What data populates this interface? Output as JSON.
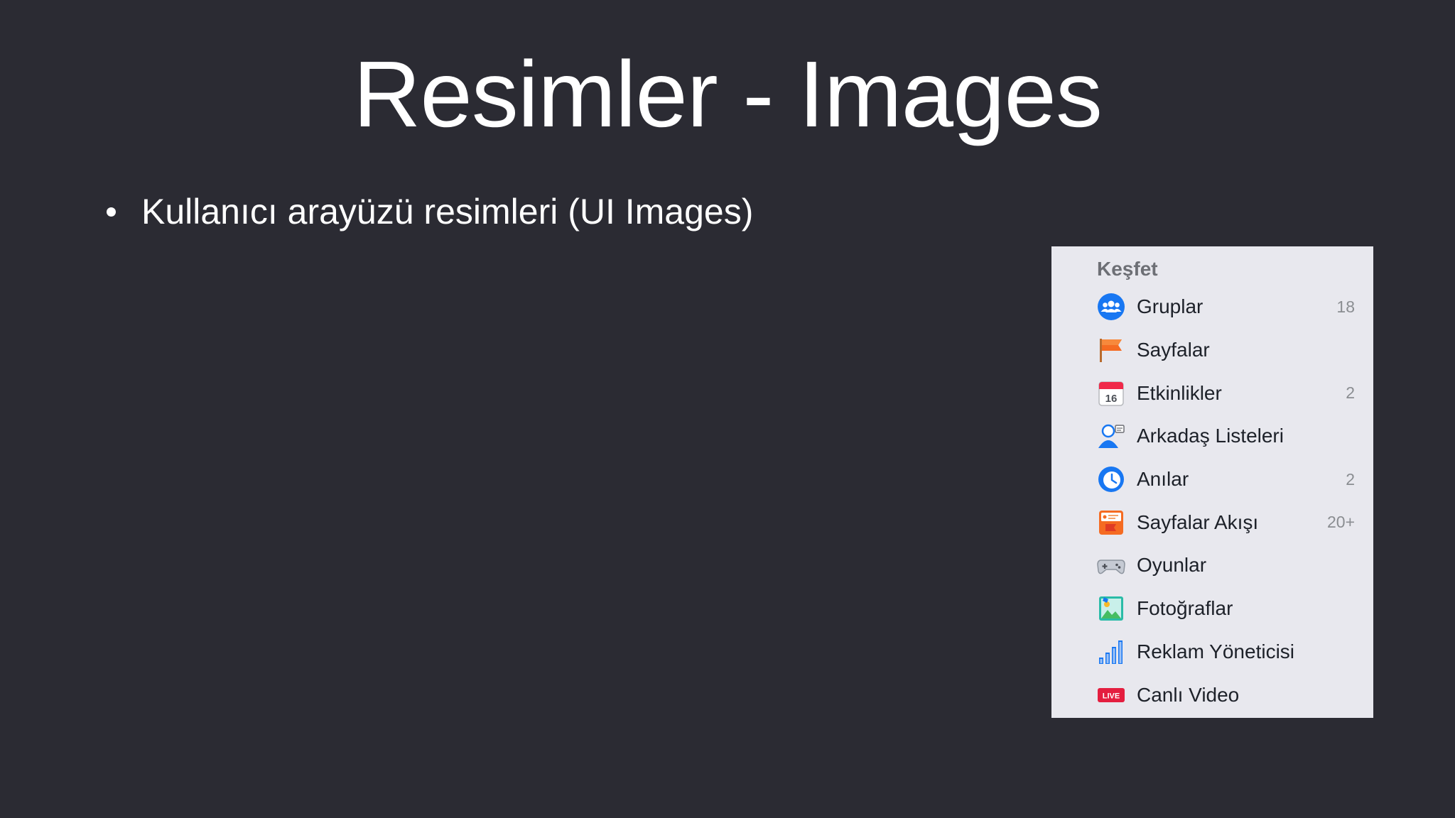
{
  "slide": {
    "title": "Resimler - Images",
    "bullet": "Kullanıcı arayüzü resimleri (UI Images)"
  },
  "panel": {
    "heading": "Keşfet",
    "items": [
      {
        "label": "Gruplar",
        "count": "18",
        "icon": "groups-icon"
      },
      {
        "label": "Sayfalar",
        "count": "",
        "icon": "flag-icon"
      },
      {
        "label": "Etkinlikler",
        "count": "2",
        "icon": "calendar-icon",
        "icon_text": "16"
      },
      {
        "label": "Arkadaş Listeleri",
        "count": "",
        "icon": "friend-list-icon"
      },
      {
        "label": "Anılar",
        "count": "2",
        "icon": "memories-clock-icon"
      },
      {
        "label": "Sayfalar Akışı",
        "count": "20+",
        "icon": "pages-feed-icon"
      },
      {
        "label": "Oyunlar",
        "count": "",
        "icon": "gamepad-icon"
      },
      {
        "label": "Fotoğraflar",
        "count": "",
        "icon": "photos-icon"
      },
      {
        "label": "Reklam Yöneticisi",
        "count": "",
        "icon": "bar-chart-icon"
      },
      {
        "label": "Canlı Video",
        "count": "",
        "icon": "live-video-icon",
        "icon_text": "LIVE"
      }
    ]
  },
  "colors": {
    "background": "#2b2b33",
    "panel": "#e8e8ee",
    "facebook_blue": "#1877f2"
  }
}
